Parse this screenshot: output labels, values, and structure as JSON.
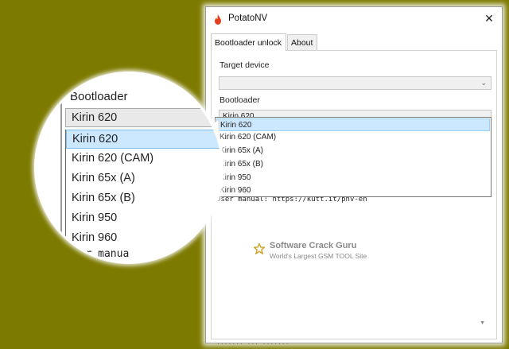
{
  "window": {
    "title": "PotatoNV",
    "close_glyph": "✕"
  },
  "tabs": [
    {
      "label": "Bootloader unlock",
      "active": true
    },
    {
      "label": "About",
      "active": false
    }
  ],
  "form": {
    "target_label": "Target device",
    "target_value": "",
    "bootloader_label": "Bootloader",
    "bootloader_value": "Kirin 620",
    "chevron": "⌄"
  },
  "dropdown": {
    "options": [
      "Kirin 620",
      "Kirin 620 (CAM)",
      "Kirin 65x (A)",
      "Kirin 65x (B)",
      "Kirin 950",
      "Kirin 960"
    ],
    "selected": "Kirin 620"
  },
  "log": {
    "line": "User manual: https://kutt.it/pnv-en",
    "scroll_arrow": "▼",
    "bottom_fragment": "·······  ···  ·······"
  },
  "watermark": {
    "title": "Software Crack Guru",
    "subtitle": "World's Largest GSM TOOL Site"
  },
  "magnifier": {
    "label": "Bootloader",
    "combo_value": "Kirin 620",
    "options": [
      "Kirin 620",
      "Kirin 620 (CAM)",
      "Kirin 65x (A)",
      "Kirin 65x (B)",
      "Kirin 950",
      "Kirin 960"
    ],
    "bottom_fragment": "User manua"
  },
  "colors": {
    "background": "#7d7a00",
    "selection": "#cce8ff",
    "icon": "#e2401b"
  },
  "icons": {
    "app": "flame-icon",
    "watermark": "star-icon"
  }
}
